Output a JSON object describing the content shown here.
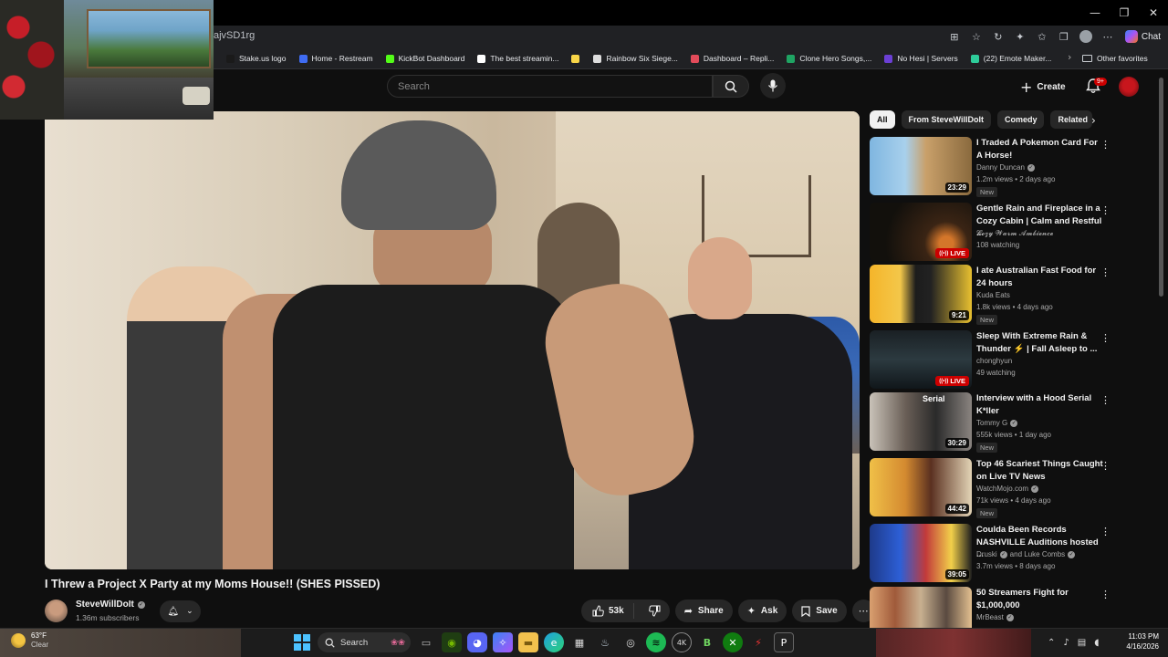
{
  "browser": {
    "url": "ajvSD1rg",
    "window_controls": [
      "—",
      "❐",
      "✕"
    ],
    "chat_label": "Chat",
    "bookmarks": [
      {
        "label": "Stake.us logo",
        "color": "#1a1a1a"
      },
      {
        "label": "Home - Restream",
        "color": "#3f6cf3"
      },
      {
        "label": "KickBot Dashboard",
        "color": "#53fc18"
      },
      {
        "label": "The best streamin...",
        "color": "#ffffff"
      },
      {
        "label": "",
        "color": "#f9d648"
      },
      {
        "label": "Rainbow Six Siege...",
        "color": "#dddddd"
      },
      {
        "label": "Dashboard – Repli...",
        "color": "#e34b5a"
      },
      {
        "label": "Clone Hero Songs,...",
        "color": "#1fa463"
      },
      {
        "label": "No Hesi | Servers",
        "color": "#6b3fd4"
      },
      {
        "label": "(22) Emote Maker...",
        "color": "#2ecc9a"
      }
    ],
    "other_favorites": "Other favorites"
  },
  "youtube": {
    "search_placeholder": "Search",
    "create_label": "Create",
    "notification_count": "9+",
    "video": {
      "title": "I Threw a Project X Party at my Moms House!! (SHES PISSED)",
      "channel": "SteveWillDoIt",
      "subscribers": "1.36m subscribers",
      "likes": "53k",
      "share_label": "Share",
      "ask_label": "Ask",
      "save_label": "Save"
    },
    "chips": [
      "All",
      "From SteveWillDoIt",
      "Comedy",
      "Related"
    ],
    "recommendations": [
      {
        "title": "I Traded A Pokemon Card For A Horse!",
        "channel": "Danny Duncan",
        "verified": true,
        "meta": "1.2m views • 2 days ago",
        "badge": "New",
        "duration": "23:29",
        "live": false
      },
      {
        "title": "Gentle Rain and Fireplace in a Cozy Cabin | Calm and Restful ...",
        "channel": "𝓒𝓸𝔃𝔂 𝓦𝓪𝓻𝓶 𝓐𝓶𝓫𝓲𝓮𝓷𝓬𝓮",
        "verified": false,
        "meta": "108 watching",
        "badge": "",
        "duration": "",
        "live": true
      },
      {
        "title": "I ate Australian Fast Food for 24 hours",
        "channel": "Kuda Eats",
        "verified": false,
        "meta": "1.8k views • 4 days ago",
        "badge": "New",
        "duration": "9:21",
        "live": false
      },
      {
        "title": "Sleep With Extreme Rain & Thunder ⚡ | Fall Asleep to ...",
        "channel": "chonghyun",
        "verified": false,
        "meta": "49 watching",
        "badge": "",
        "duration": "",
        "live": true
      },
      {
        "title": "Interview with a Hood Serial K*ller",
        "channel": "Tommy G",
        "verified": true,
        "meta": "555k views • 1 day ago",
        "badge": "New",
        "duration": "30:29",
        "live": false
      },
      {
        "title": "Top 46 Scariest Things Caught on Live TV News",
        "channel": "WatchMojo.com",
        "verified": true,
        "meta": "71k views • 4 days ago",
        "badge": "New",
        "duration": "44:42",
        "live": false
      },
      {
        "title": "Coulda Been Records NASHVILLE Auditions hosted ...",
        "channel": "Druski",
        "channel2": "and Luke Combs",
        "verified": true,
        "meta": "3.7m views • 8 days ago",
        "badge": "",
        "duration": "39:05",
        "live": false
      },
      {
        "title": "50 Streamers Fight for $1,000,000",
        "channel": "MrBeast",
        "verified": true,
        "meta": "",
        "badge": "",
        "duration": "",
        "live": false
      }
    ],
    "live_label": "LIVE",
    "thumb_text_serial": "Serial"
  },
  "taskbar": {
    "weather_temp": "63°F",
    "weather_cond": "Clear",
    "search_label": "Search",
    "time": "11:03 PM",
    "date": "4/16/2026"
  },
  "colors": {
    "yt_red": "#cc0000",
    "bg": "#0f0f0f",
    "chip_bg": "#272727"
  }
}
